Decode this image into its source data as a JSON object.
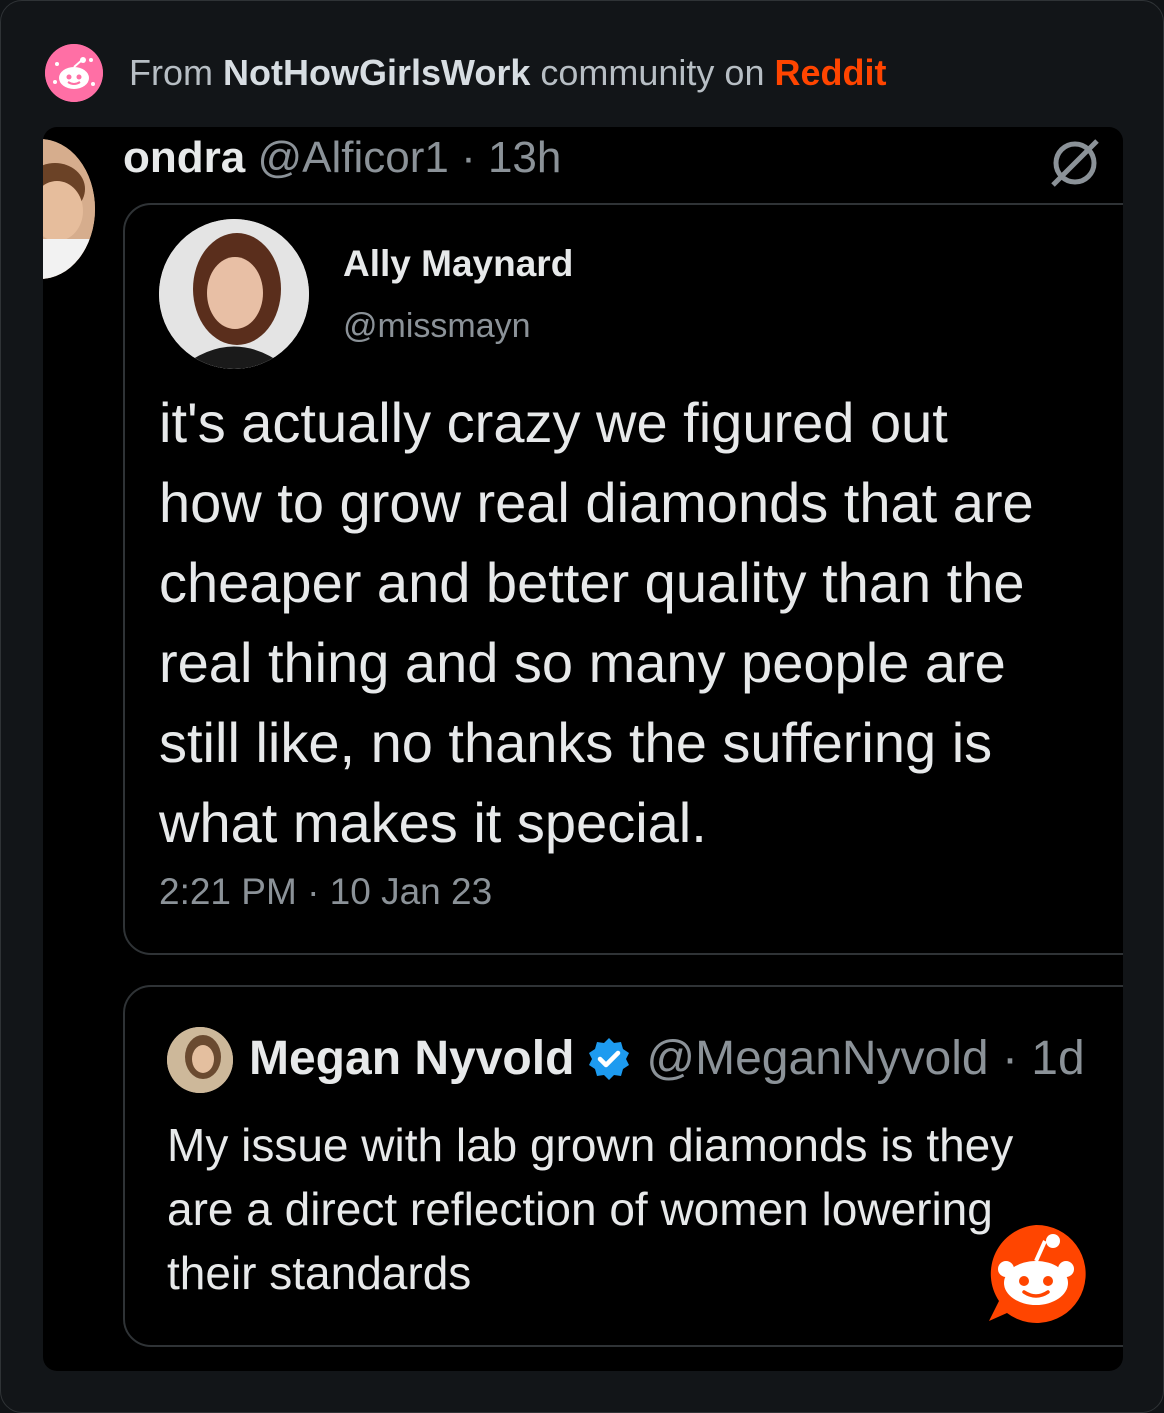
{
  "header": {
    "prefix": "From",
    "community": "NotHowGirlsWork",
    "middle": "community on",
    "platform": "Reddit",
    "subreddit_icon": "subreddit-avatar-icon"
  },
  "outer_tweet": {
    "display_name": "ondra",
    "handle_time": "@Alficor1 · 13h",
    "avatar": "user-avatar",
    "corner_icon": "null-symbol-icon"
  },
  "quoted_tweet": {
    "display_name": "Ally Maynard",
    "handle": "@missmayn",
    "lines": [
      "it's actually crazy we figured out",
      "how to grow real diamonds that are",
      "cheaper and better quality than the",
      "real thing and so many people are",
      "still like, no thanks the suffering is",
      "what makes it special."
    ],
    "timestamp": "2:21 PM · 10 Jan 23"
  },
  "reply_tweet": {
    "display_name": "Megan Nyvold",
    "verified_icon": "verified-badge-icon",
    "handle_time": "@MeganNyvold · 1d",
    "lines": [
      "My issue with lab grown diamonds is they",
      "are a direct reflection of women lowering",
      "their standards"
    ]
  },
  "overlay": {
    "icon": "reddit-snoo-icon"
  },
  "colors": {
    "reddit_orange": "#ff4500",
    "verified_blue": "#1d9bf0",
    "background": "#000000",
    "frame": "#121518"
  }
}
